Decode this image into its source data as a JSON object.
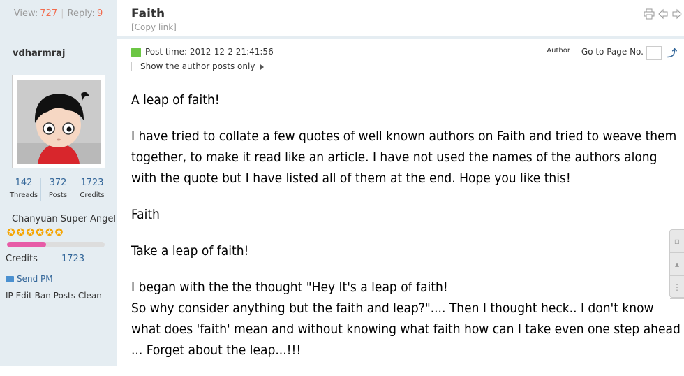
{
  "sidebar": {
    "view_label": "View:",
    "view_count": "727",
    "reply_label": "Reply:",
    "reply_count": "9",
    "username": "vdharmraj",
    "stats": [
      {
        "value": "142",
        "label": "Threads"
      },
      {
        "value": "372",
        "label": "Posts"
      },
      {
        "value": "1723",
        "label": "Credits"
      }
    ],
    "rank": "Chanyuan Super Angel",
    "stars": 6,
    "progress_fraction": 0.4,
    "credits_label": "Credits",
    "credits_value": "1723",
    "send_pm": "Send PM",
    "admin_links": "IP Edit Ban Posts Clean"
  },
  "header": {
    "title": "Faith",
    "copy_link": "[Copy link]",
    "icons": [
      "print-icon",
      "previous-thread-icon",
      "next-thread-icon"
    ]
  },
  "post": {
    "time_label": "Post time: 2012-12-2 21:41:56",
    "show_author_only": "Show the author posts only",
    "author_label": "Author",
    "goto_page": "Go to Page No.",
    "paragraphs": [
      "A leap of faith!",
      "I have tried to collate a few quotes of well known authors on Faith and tried to weave them together,  to make it read like an article. I have not used the names of the authors along with the quote but I have listed all of them at the end. Hope you like this!",
      "Faith",
      "Take a leap of faith!",
      "I began with the the thought \"Hey It's a leap of faith!",
      "So why consider anything but the faith and leap?\".... Then I thought heck.. I don't know what does  'faith' mean and without knowing what faith how can I take  even one step ahead ... Forget about the leap...!!!"
    ]
  },
  "colors": {
    "sidebar_bg": "#e5edf2",
    "link": "#336699",
    "count": "#f26c4f",
    "progress": "#e75ba7",
    "star": "#f5a400"
  }
}
